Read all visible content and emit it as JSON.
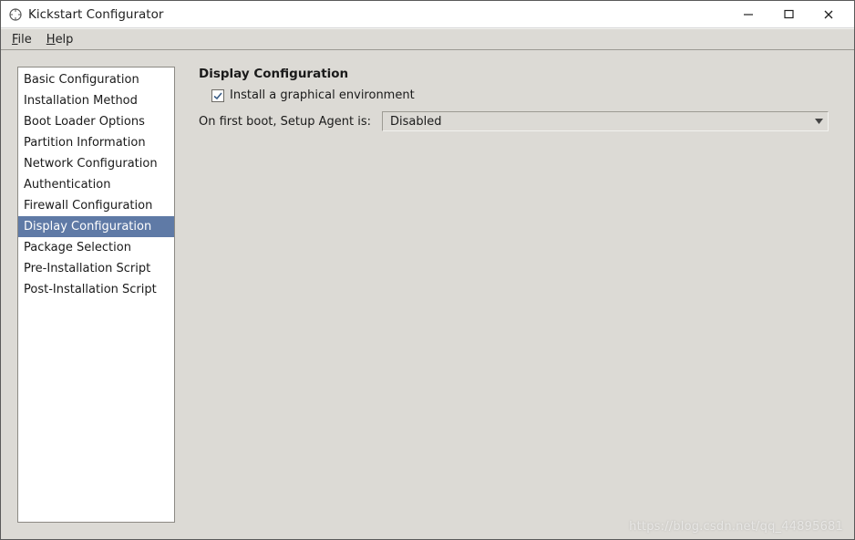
{
  "window": {
    "title": "Kickstart Configurator"
  },
  "menubar": {
    "file": "File",
    "help": "Help"
  },
  "sidebar": {
    "items": [
      {
        "label": "Basic Configuration",
        "selected": false
      },
      {
        "label": "Installation Method",
        "selected": false
      },
      {
        "label": "Boot Loader Options",
        "selected": false
      },
      {
        "label": "Partition Information",
        "selected": false
      },
      {
        "label": "Network Configuration",
        "selected": false
      },
      {
        "label": "Authentication",
        "selected": false
      },
      {
        "label": "Firewall Configuration",
        "selected": false
      },
      {
        "label": "Display Configuration",
        "selected": true
      },
      {
        "label": "Package Selection",
        "selected": false
      },
      {
        "label": "Pre-Installation Script",
        "selected": false
      },
      {
        "label": "Post-Installation Script",
        "selected": false
      }
    ]
  },
  "main": {
    "section_title": "Display Configuration",
    "install_graphical_label": "Install a graphical environment",
    "install_graphical_checked": true,
    "setup_agent_label": "On first boot, Setup Agent is:",
    "setup_agent_value": "Disabled"
  },
  "watermark": "https://blog.csdn.net/qq_44895681"
}
